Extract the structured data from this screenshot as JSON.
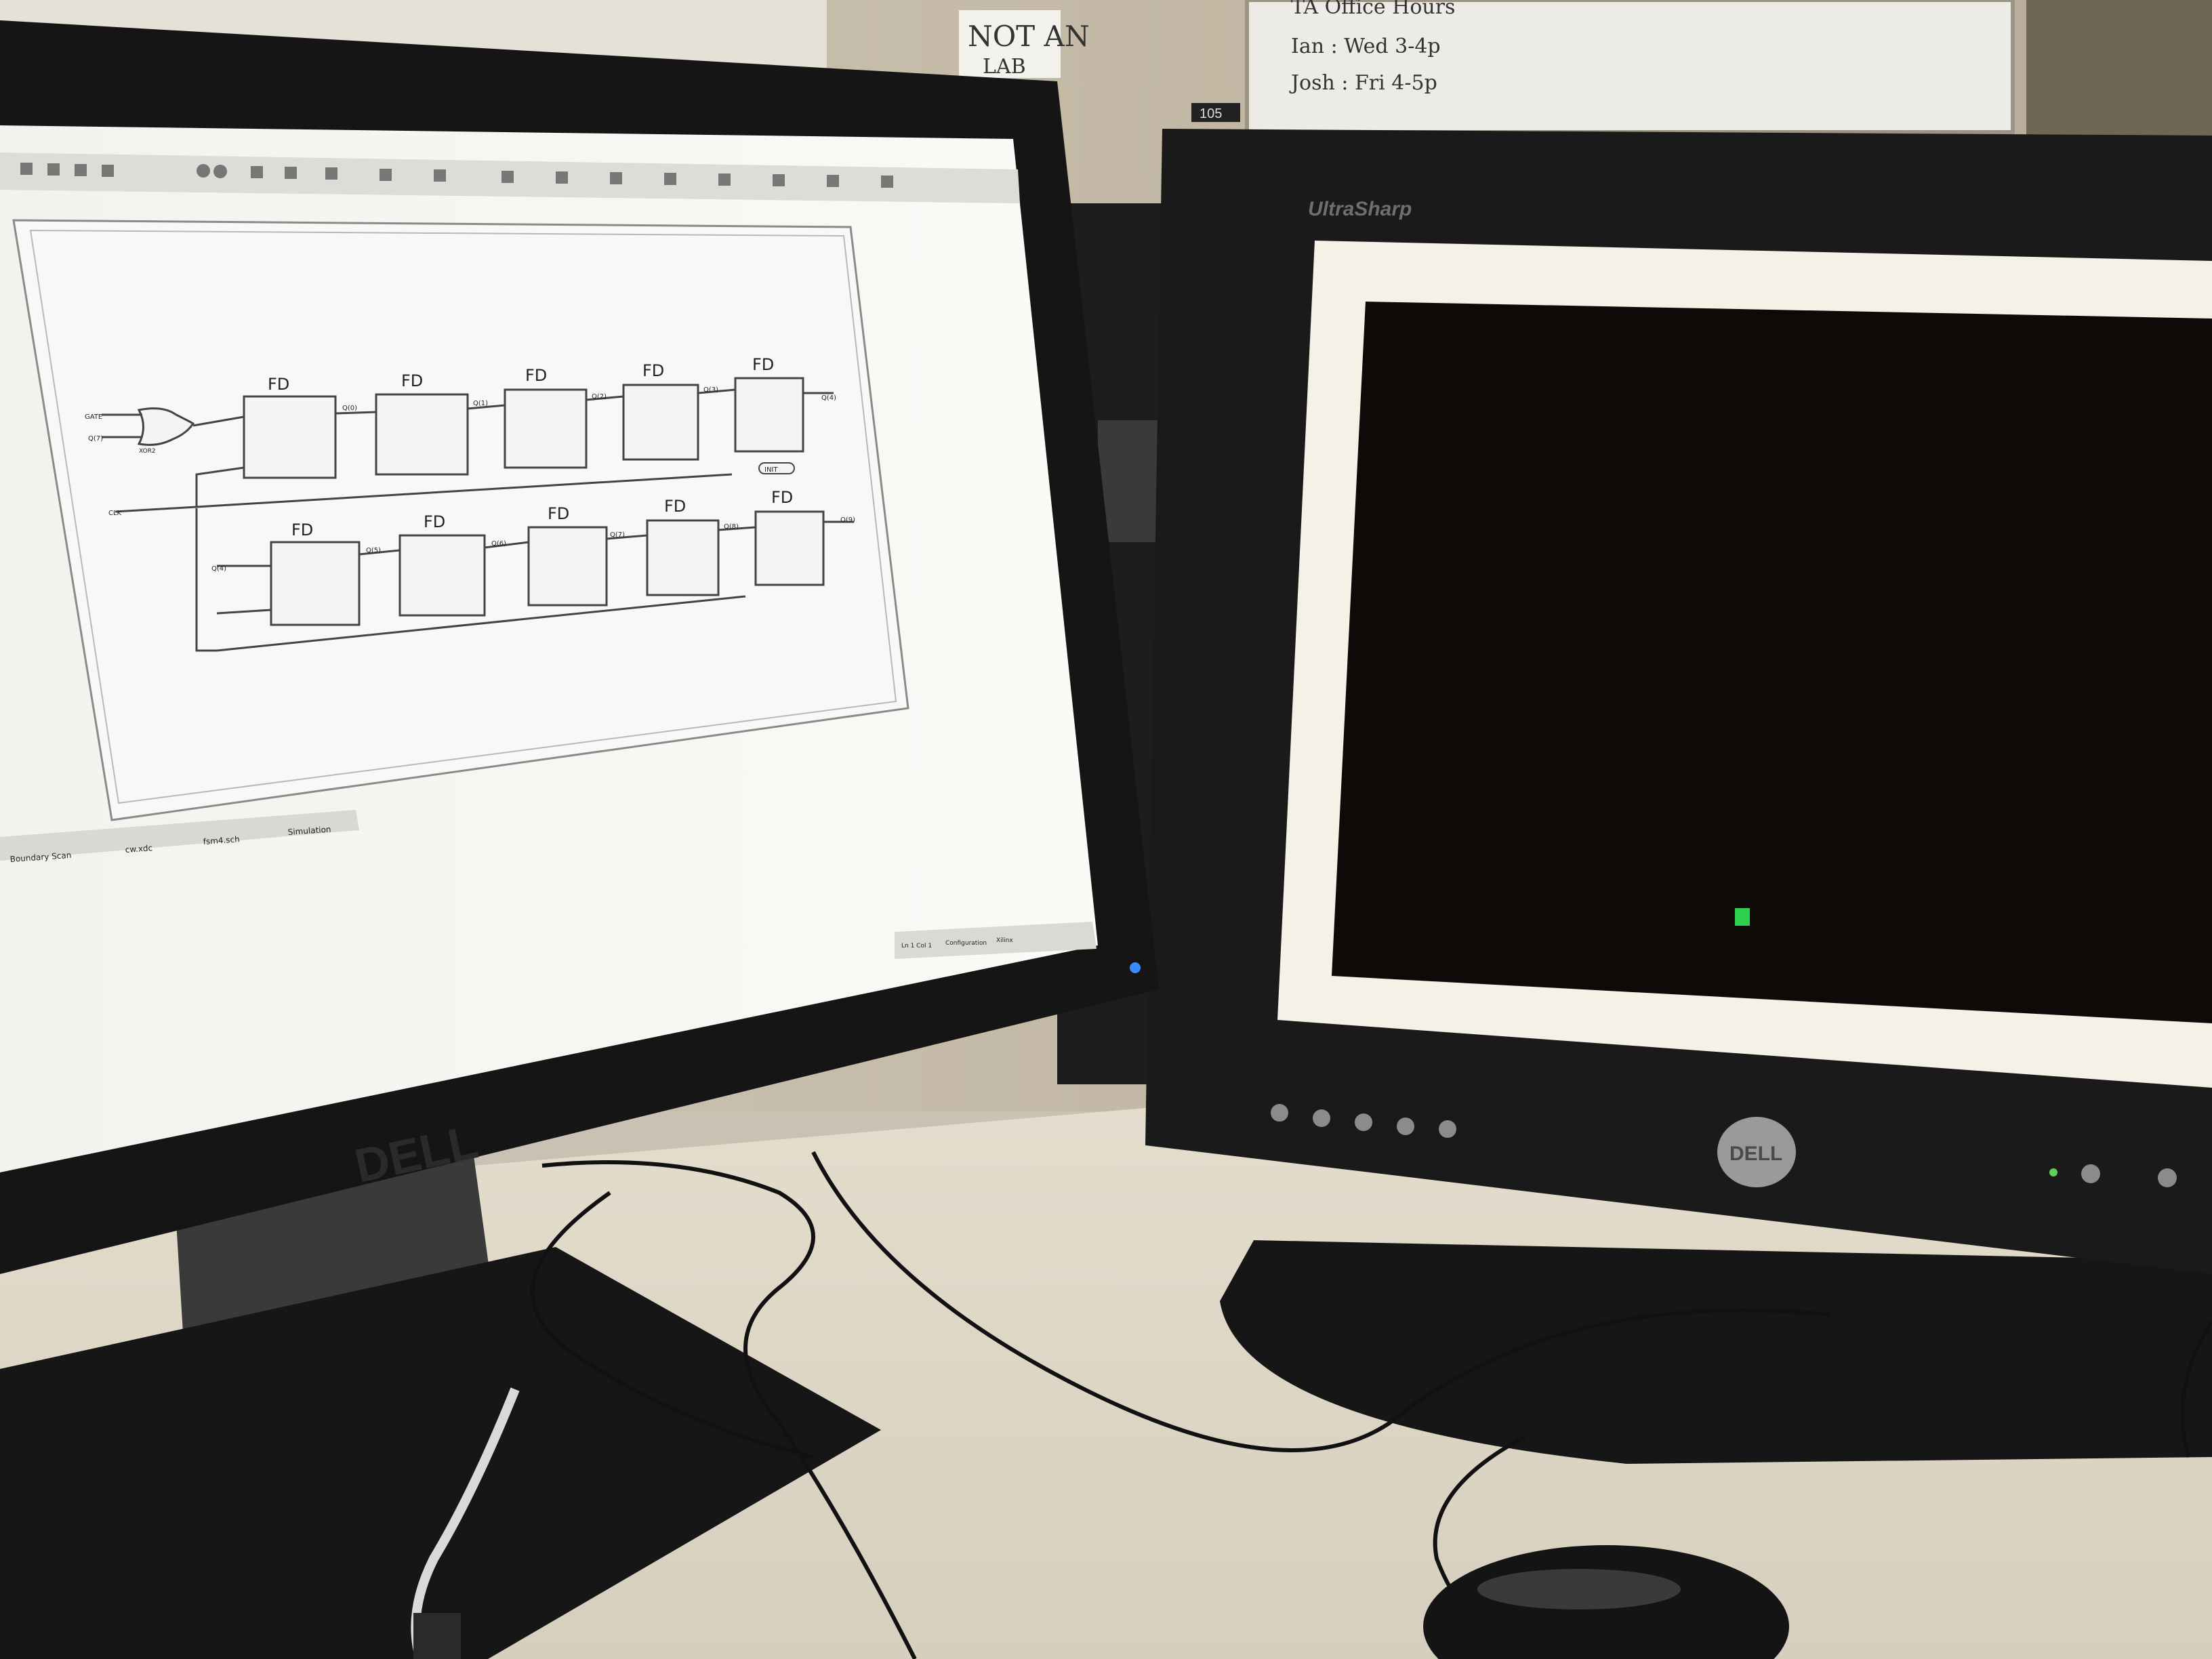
{
  "sign": {
    "line1": "NOT AN",
    "line2": "LAB"
  },
  "whiteboard": {
    "heading": "TA Office Hours",
    "row1": "Ian : Wed 3-4p",
    "row2": "Josh : Fri 4-5p"
  },
  "room_tag": "105",
  "left_monitor": {
    "brand": "DELL",
    "schematic": {
      "flipflop_label": "FD",
      "input_top_1": "GATE",
      "input_top_2": "Q(7)",
      "gate_label": "XOR2",
      "clk_label": "CLK",
      "top_nets": [
        "Q(0)",
        "Q(1)",
        "Q(2)",
        "Q(3)"
      ],
      "top_out": "Q(4)",
      "bottom_in": "Q(4)",
      "bottom_nets": [
        "Q(5)",
        "Q(6)",
        "Q(7)",
        "Q(8)"
      ],
      "bottom_out": "Q(9)",
      "probe_label": "INIT"
    },
    "tabs": [
      "Boundary Scan",
      "cw.xdc",
      "fsm4.sch",
      "Simulation"
    ],
    "status": [
      "Ln 1 Col 1",
      "Configuration",
      "Xilinx"
    ]
  },
  "right_monitor": {
    "brand": "UltraSharp",
    "logo": "DELL",
    "pixel_color": "#2fd04e"
  }
}
